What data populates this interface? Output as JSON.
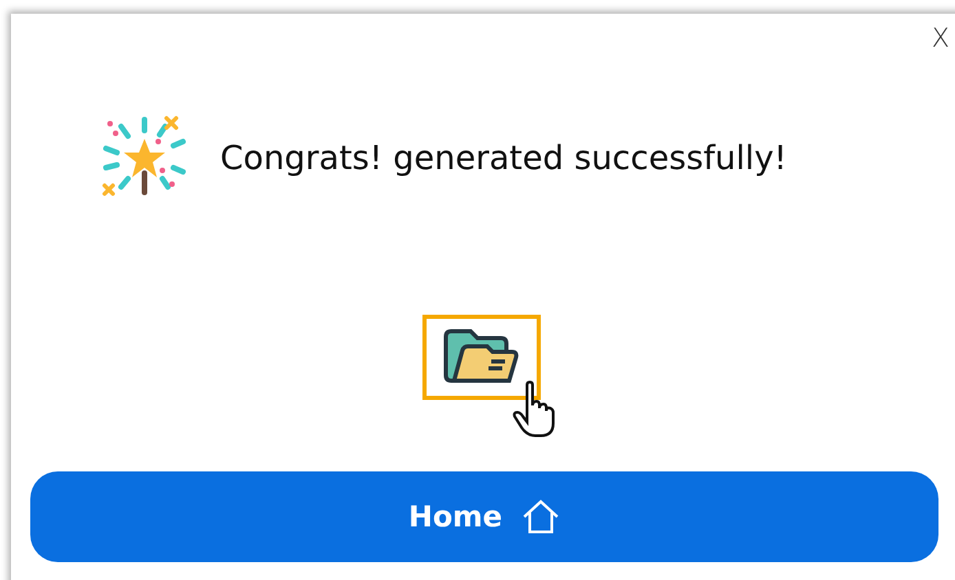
{
  "dialog": {
    "close": "X",
    "message": "Congrats! generated successfully!",
    "open_folder": {
      "focused": true
    },
    "home_button": "Home"
  }
}
